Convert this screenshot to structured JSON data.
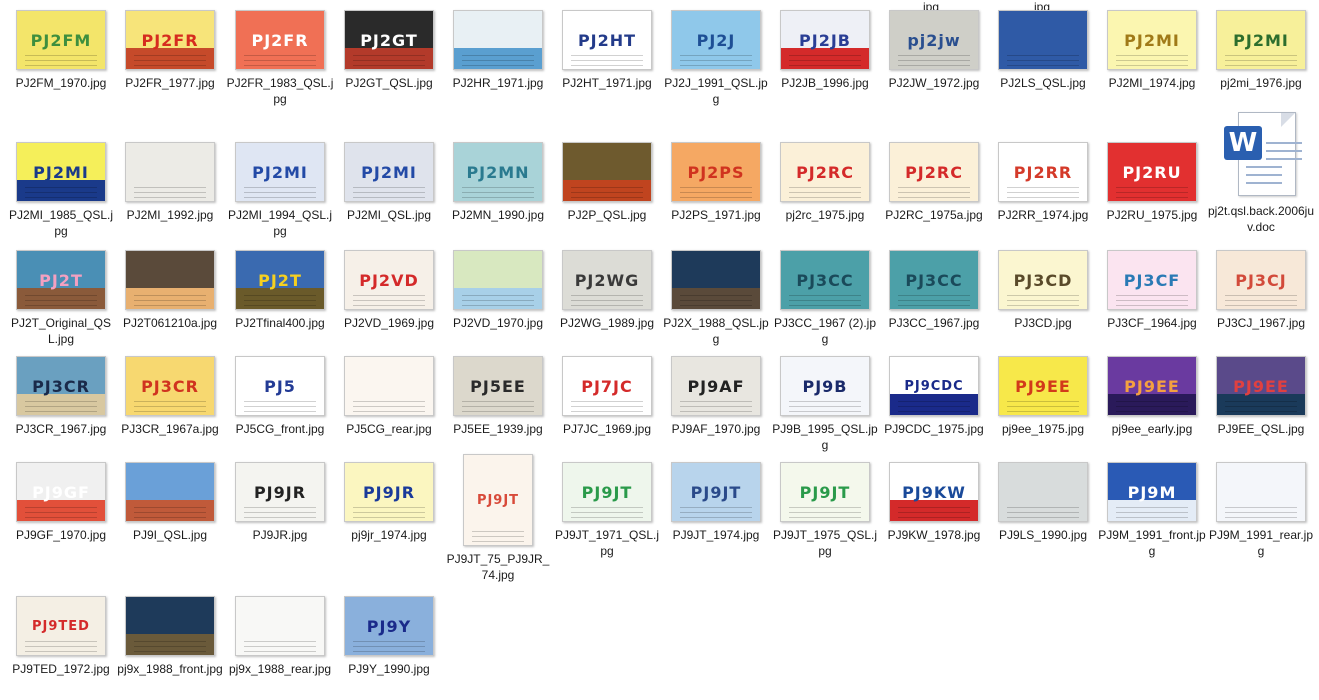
{
  "topcut": "jpg",
  "files": [
    {
      "name": "PJ2FM_1970.jpg",
      "thumb": {
        "bg": "#f3e56a",
        "text": "PJ2FM",
        "fg": "#3e8f3e"
      }
    },
    {
      "name": "PJ2FR_1977.jpg",
      "thumb": {
        "bg": "#f7e47a",
        "text": "PJ2FR",
        "fg": "#d62c1f",
        "band": "#c64a2a"
      }
    },
    {
      "name": "PJ2FR_1983_QSL.jpg",
      "thumb": {
        "bg": "#f07055",
        "text": "PJ2FR",
        "fg": "#ffffff"
      }
    },
    {
      "name": "PJ2GT_QSL.jpg",
      "thumb": {
        "bg": "#2a2a2a",
        "text": "PJ2GT",
        "fg": "#ffffff",
        "band": "#b33a2a"
      }
    },
    {
      "name": "PJ2HR_1971.jpg",
      "thumb": {
        "bg": "#e8f0f4",
        "text": "",
        "fg": "#2a6bb0",
        "band": "#5a9fd0"
      }
    },
    {
      "name": "PJ2HT_1971.jpg",
      "thumb": {
        "bg": "#ffffff",
        "text": "PJ2HT",
        "fg": "#233b8a"
      }
    },
    {
      "name": "PJ2J_1991_QSL.jpg",
      "thumb": {
        "bg": "#8fc8ea",
        "text": "PJ2J",
        "fg": "#1e4f95"
      }
    },
    {
      "name": "PJ2JB_1996.jpg",
      "thumb": {
        "bg": "#eef0f6",
        "text": "PJ2JB",
        "fg": "#2a3e95",
        "band": "#d42a2a"
      }
    },
    {
      "name": "PJ2JW_1972.jpg",
      "thumb": {
        "bg": "#cfcfc8",
        "text": "pj2jw",
        "fg": "#2a4f8f"
      }
    },
    {
      "name": "PJ2LS_QSL.jpg",
      "thumb": {
        "bg": "#2f5aa6",
        "text": "",
        "fg": "#ffffff"
      }
    },
    {
      "name": "PJ2MI_1974.jpg",
      "thumb": {
        "bg": "#fbf6b0",
        "text": "PJ2MI",
        "fg": "#a07a18"
      }
    },
    {
      "name": "pj2mi_1976.jpg",
      "thumb": {
        "bg": "#f7f09a",
        "text": "PJ2MI",
        "fg": "#2d6e2d"
      }
    },
    {
      "name": "PJ2MI_1985_QSL.jpg",
      "thumb": {
        "bg": "#f5ef5a",
        "text": "PJ2MI",
        "fg": "#1a3a8a",
        "band": "#1a3a8a"
      }
    },
    {
      "name": "PJ2MI_1992.jpg",
      "thumb": {
        "bg": "#ecebe6",
        "text": "",
        "fg": "#8a2a2a"
      }
    },
    {
      "name": "PJ2MI_1994_QSL.jpg",
      "thumb": {
        "bg": "#dfe6f3",
        "text": "PJ2MI",
        "fg": "#234aa6"
      }
    },
    {
      "name": "PJ2MI_QSL.jpg",
      "thumb": {
        "bg": "#dfe3ec",
        "text": "PJ2MI",
        "fg": "#234aa6"
      }
    },
    {
      "name": "PJ2MN_1990.jpg",
      "thumb": {
        "bg": "#a9d3d8",
        "text": "PJ2MN",
        "fg": "#2a7a8f"
      }
    },
    {
      "name": "PJ2P_QSL.jpg",
      "thumb": {
        "bg": "#6e5a2e",
        "text": "",
        "fg": "#ffffff",
        "band": "#c0441f"
      }
    },
    {
      "name": "PJ2PS_1971.jpg",
      "thumb": {
        "bg": "#f5a863",
        "text": "PJ2PS",
        "fg": "#d0331f"
      }
    },
    {
      "name": "pj2rc_1975.jpg",
      "thumb": {
        "bg": "#fbf0d8",
        "text": "PJ2RC",
        "fg": "#d42a2a"
      }
    },
    {
      "name": "PJ2RC_1975a.jpg",
      "thumb": {
        "bg": "#fbf0d8",
        "text": "PJ2RC",
        "fg": "#d42a2a"
      }
    },
    {
      "name": "PJ2RR_1974.jpg",
      "thumb": {
        "bg": "#ffffff",
        "text": "PJ2RR",
        "fg": "#d43a2a"
      }
    },
    {
      "name": "PJ2RU_1975.jpg",
      "thumb": {
        "bg": "#e23030",
        "text": "PJ2RU",
        "fg": "#ffffff"
      }
    },
    {
      "name": "pj2t.qsl.back.2006juv.doc",
      "doc": true
    },
    {
      "name": "PJ2T_Original_QSL.jpg",
      "thumb": {
        "bg": "#4a8fb5",
        "text": "PJ2T",
        "fg": "#f4a0c0",
        "band": "#8a5a3a"
      }
    },
    {
      "name": "PJ2T061210a.jpg",
      "thumb": {
        "bg": "#5a4a3a",
        "text": "",
        "fg": "#fff",
        "band": "#e8b070"
      }
    },
    {
      "name": "PJ2Tfinal400.jpg",
      "thumb": {
        "bg": "#3a6ab0",
        "text": "PJ2T",
        "fg": "#f5d020",
        "band": "#6a5a2a"
      }
    },
    {
      "name": "PJ2VD_1969.jpg",
      "thumb": {
        "bg": "#f6f0e8",
        "text": "PJ2VD",
        "fg": "#d42a2a"
      }
    },
    {
      "name": "PJ2VD_1970.jpg",
      "thumb": {
        "bg": "#d8e8c0",
        "text": "",
        "fg": "#8a5a2a",
        "band": "#a8d0e8"
      }
    },
    {
      "name": "PJ2WG_1989.jpg",
      "thumb": {
        "bg": "#dcdcd6",
        "text": "PJ2WG",
        "fg": "#3a3a3a"
      }
    },
    {
      "name": "PJ2X_1988_QSL.jpg",
      "thumb": {
        "bg": "#1e3a5a",
        "text": "",
        "fg": "#fff",
        "band": "#5a4a3a"
      }
    },
    {
      "name": "PJ3CC_1967 (2).jpg",
      "thumb": {
        "bg": "#4ca0a8",
        "text": "PJ3CC",
        "fg": "#1a4a5a"
      }
    },
    {
      "name": "PJ3CC_1967.jpg",
      "thumb": {
        "bg": "#4ca0a8",
        "text": "PJ3CC",
        "fg": "#1a4a5a"
      }
    },
    {
      "name": "PJ3CD.jpg",
      "thumb": {
        "bg": "#fbf6d0",
        "text": "PJ3CD",
        "fg": "#5a4a2a"
      }
    },
    {
      "name": "PJ3CF_1964.jpg",
      "thumb": {
        "bg": "#fbe4f0",
        "text": "PJ3CF",
        "fg": "#2a7ab5"
      }
    },
    {
      "name": "PJ3CJ_1967.jpg",
      "thumb": {
        "bg": "#f7e8d8",
        "text": "PJ3CJ",
        "fg": "#d24a3a"
      }
    },
    {
      "name": "PJ3CR_1967.jpg",
      "thumb": {
        "bg": "#6aa0c0",
        "text": "PJ3CR",
        "fg": "#1a2a4a",
        "band": "#d8c8a0"
      }
    },
    {
      "name": "PJ3CR_1967a.jpg",
      "thumb": {
        "bg": "#f7d870",
        "text": "PJ3CR",
        "fg": "#d0331f"
      }
    },
    {
      "name": "PJ5CG_front.jpg",
      "thumb": {
        "bg": "#ffffff",
        "text": "PJ5",
        "fg": "#233b95"
      }
    },
    {
      "name": "PJ5CG_rear.jpg",
      "thumb": {
        "bg": "#fbf6f0",
        "text": "",
        "fg": "#c0302a"
      }
    },
    {
      "name": "PJ5EE_1939.jpg",
      "thumb": {
        "bg": "#dcd8cc",
        "text": "PJ5EE",
        "fg": "#2a2a2a"
      }
    },
    {
      "name": "PJ7JC_1969.jpg",
      "thumb": {
        "bg": "#ffffff",
        "text": "PJ7JC",
        "fg": "#d42a2a"
      }
    },
    {
      "name": "PJ9AF_1970.jpg",
      "thumb": {
        "bg": "#e8e6e0",
        "text": "PJ9AF",
        "fg": "#222222"
      }
    },
    {
      "name": "PJ9B_1995_QSL.jpg",
      "thumb": {
        "bg": "#f4f6fa",
        "text": "PJ9B",
        "fg": "#1a2a6a"
      }
    },
    {
      "name": "PJ9CDC_1975.jpg",
      "thumb": {
        "bg": "#ffffff",
        "text": "PJ9CDC",
        "fg": "#1a2a8a",
        "band": "#1a2a8a"
      }
    },
    {
      "name": "pj9ee_1975.jpg",
      "thumb": {
        "bg": "#f7e84a",
        "text": "PJ9EE",
        "fg": "#d23a1a"
      }
    },
    {
      "name": "pj9ee_early.jpg",
      "thumb": {
        "bg": "#6a3aa0",
        "text": "PJ9EE",
        "fg": "#f4a040",
        "band": "#2a1a5a"
      }
    },
    {
      "name": "PJ9EE_QSL.jpg",
      "thumb": {
        "bg": "#5a4a8a",
        "text": "PJ9EE",
        "fg": "#e04040",
        "band": "#1a3a5a"
      }
    },
    {
      "name": "PJ9GF_1970.jpg",
      "thumb": {
        "bg": "#f0f0f0",
        "text": "PJ9GF",
        "fg": "#ffffff",
        "band": "#e2503a"
      }
    },
    {
      "name": "PJ9I_QSL.jpg",
      "thumb": {
        "bg": "#6aa0d8",
        "text": "",
        "fg": "#fff",
        "band": "#c05a3a"
      }
    },
    {
      "name": "PJ9JR.jpg",
      "thumb": {
        "bg": "#f4f4f0",
        "text": "PJ9JR",
        "fg": "#222222"
      }
    },
    {
      "name": "pj9jr_1974.jpg",
      "thumb": {
        "bg": "#fbf6c0",
        "text": "PJ9JR",
        "fg": "#1a3a9a"
      }
    },
    {
      "name": "PJ9JT_75_PJ9JR_74.jpg",
      "tall": true,
      "thumb": {
        "bg": "#fbf4ec",
        "text": "PJ9JT",
        "fg": "#d84a3a"
      }
    },
    {
      "name": "PJ9JT_1971_QSL.jpg",
      "thumb": {
        "bg": "#eef6ec",
        "text": "PJ9JT",
        "fg": "#2a9a4a"
      }
    },
    {
      "name": "PJ9JT_1974.jpg",
      "thumb": {
        "bg": "#b8d4ec",
        "text": "PJ9JT",
        "fg": "#2a4a8a"
      }
    },
    {
      "name": "PJ9JT_1975_QSL.jpg",
      "thumb": {
        "bg": "#f4f8ec",
        "text": "PJ9JT",
        "fg": "#2a9a4a"
      }
    },
    {
      "name": "PJ9KW_1978.jpg",
      "thumb": {
        "bg": "#ffffff",
        "text": "PJ9KW",
        "fg": "#1a4a9a",
        "band": "#d42a2a"
      }
    },
    {
      "name": "PJ9LS_1990.jpg",
      "thumb": {
        "bg": "#d8dcdc",
        "text": "",
        "fg": "#3a3a3a"
      }
    },
    {
      "name": "PJ9M_1991_front.jpg",
      "thumb": {
        "bg": "#2a5ab5",
        "text": "PJ9M",
        "fg": "#ffffff",
        "band": "#e4ecf6"
      }
    },
    {
      "name": "PJ9M_1991_rear.jpg",
      "thumb": {
        "bg": "#f4f6fa",
        "text": "",
        "fg": "#2a4a9a"
      }
    },
    {
      "name": "PJ9TED_1972.jpg",
      "thumb": {
        "bg": "#f4efe4",
        "text": "PJ9TED",
        "fg": "#d42a2a"
      }
    },
    {
      "name": "pj9x_1988_front.jpg",
      "thumb": {
        "bg": "#1e3a5a",
        "text": "",
        "fg": "#fff",
        "band": "#6a5a3a"
      }
    },
    {
      "name": "pj9x_1988_rear.jpg",
      "thumb": {
        "bg": "#f8f8f6",
        "text": "",
        "fg": "#3a3a3a"
      }
    },
    {
      "name": "PJ9Y_1990.jpg",
      "thumb": {
        "bg": "#8ab0dc",
        "text": "PJ9Y",
        "fg": "#1a2a8a"
      }
    }
  ]
}
